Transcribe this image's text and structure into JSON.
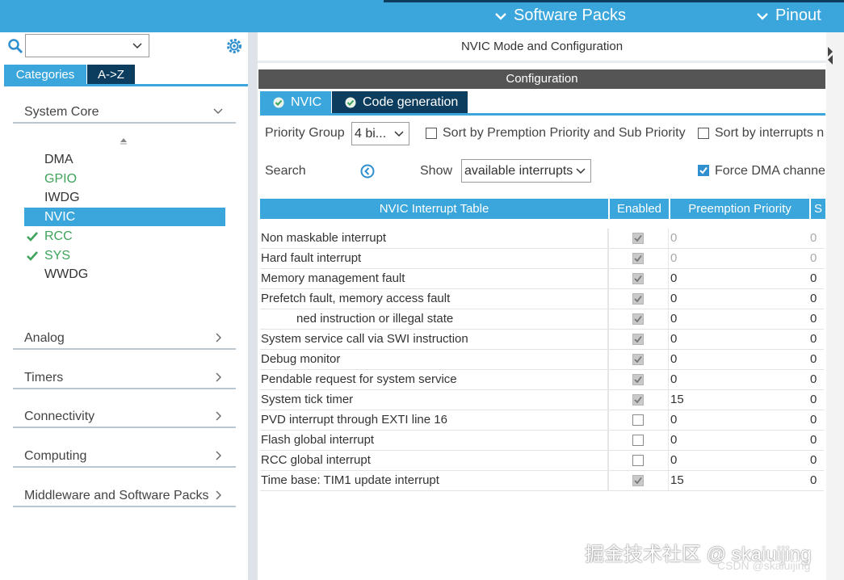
{
  "topbar": {
    "software_packs_label": "Software Packs",
    "pinout_label": "Pinout"
  },
  "left": {
    "tabs": {
      "categories": "Categories",
      "az": "A->Z"
    },
    "search_value": "",
    "categories": [
      {
        "label": "System Core",
        "expanded": true
      },
      {
        "label": "Analog"
      },
      {
        "label": "Timers"
      },
      {
        "label": "Connectivity"
      },
      {
        "label": "Computing"
      },
      {
        "label": "Middleware and Software Packs"
      }
    ],
    "system_core_items": [
      {
        "label": "DMA",
        "state": "normal"
      },
      {
        "label": "GPIO",
        "state": "green"
      },
      {
        "label": "IWDG",
        "state": "normal"
      },
      {
        "label": "NVIC",
        "state": "selected"
      },
      {
        "label": "RCC",
        "state": "checked"
      },
      {
        "label": "SYS",
        "state": "checked"
      },
      {
        "label": "WWDG",
        "state": "normal"
      }
    ]
  },
  "main": {
    "title": "NVIC Mode and Configuration",
    "config_label": "Configuration",
    "tabs": {
      "nvic": "NVIC",
      "code": "Code generation"
    },
    "priority_group_label": "Priority Group",
    "priority_group_value": "4 bi...",
    "sort_premption_label": "Sort by Premption Priority and Sub Priority",
    "sort_interrupts_label": "Sort by interrupts na",
    "search_label": "Search",
    "show_label": "Show",
    "show_value": "available interrupts",
    "force_dma_label": "Force DMA channe",
    "table": {
      "headers": [
        "NVIC Interrupt Table",
        "Enabled",
        "Preemption Priority",
        "S"
      ],
      "rows": [
        {
          "name": "Non maskable interrupt",
          "enabled": true,
          "preemption": "0",
          "sub": "0",
          "disabled": true
        },
        {
          "name": "Hard fault interrupt",
          "enabled": true,
          "preemption": "0",
          "sub": "0",
          "disabled": true
        },
        {
          "name": "Memory management fault",
          "enabled": true,
          "preemption": "0",
          "sub": "0",
          "disabled": false
        },
        {
          "name": "Prefetch fault, memory access fault",
          "enabled": true,
          "preemption": "0",
          "sub": "0",
          "disabled": false
        },
        {
          "name": "ned instruction or illegal state",
          "enabled": true,
          "preemption": "0",
          "sub": "0",
          "disabled": false
        },
        {
          "name": "System service call via SWI instruction",
          "enabled": true,
          "preemption": "0",
          "sub": "0",
          "disabled": false
        },
        {
          "name": "Debug monitor",
          "enabled": true,
          "preemption": "0",
          "sub": "0",
          "disabled": false
        },
        {
          "name": "Pendable request for system service",
          "enabled": true,
          "preemption": "0",
          "sub": "0",
          "disabled": false
        },
        {
          "name": "System tick timer",
          "enabled": true,
          "preemption": "15",
          "sub": "0",
          "disabled": false
        },
        {
          "name": "PVD interrupt through EXTI line 16",
          "enabled": false,
          "preemption": "0",
          "sub": "0",
          "disabled": false
        },
        {
          "name": "Flash global interrupt",
          "enabled": false,
          "preemption": "0",
          "sub": "0",
          "disabled": false
        },
        {
          "name": "RCC global interrupt",
          "enabled": false,
          "preemption": "0",
          "sub": "0",
          "disabled": false
        },
        {
          "name": "Time base: TIM1 update interrupt",
          "enabled": true,
          "preemption": "15",
          "sub": "0",
          "disabled": false
        }
      ]
    }
  },
  "watermark": {
    "main": "掘金技术社区 @ skaiuijing",
    "sub": "CSDN @skaiuijing"
  },
  "colors": {
    "accent": "#3aa6dc",
    "dark_tab": "#0d3d5e",
    "green": "#3ea35b"
  }
}
